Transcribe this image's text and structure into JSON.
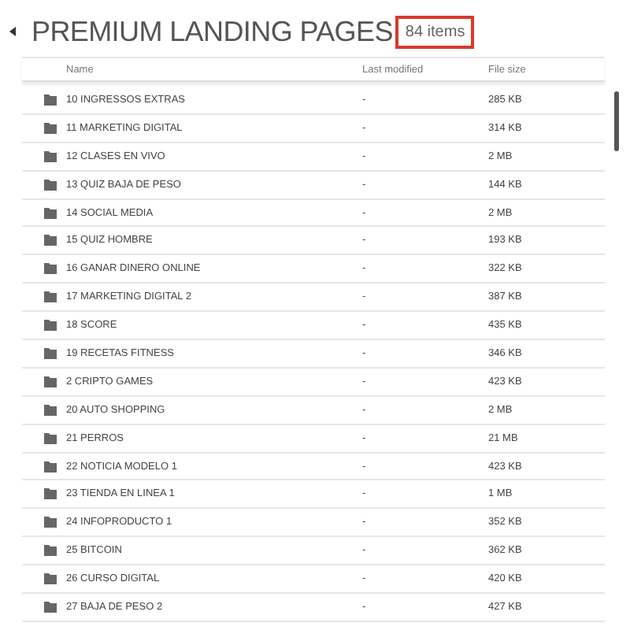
{
  "title": "PREMIUM LANDING PAGES",
  "item_count": {
    "text": "84 items",
    "highlighted": true
  },
  "table": {
    "columns": [
      "Name",
      "Last modified",
      "File size"
    ],
    "rows": [
      {
        "name": "10 INGRESSOS EXTRAS",
        "modified": "-",
        "size": "285 KB"
      },
      {
        "name": "11 MARKETING DIGITAL",
        "modified": "-",
        "size": "314 KB"
      },
      {
        "name": "12 CLASES EN VIVO",
        "modified": "-",
        "size": "2 MB"
      },
      {
        "name": "13 QUIZ BAJA DE PESO",
        "modified": "-",
        "size": "144 KB"
      },
      {
        "name": "14 SOCIAL MEDIA",
        "modified": "-",
        "size": "2 MB"
      },
      {
        "name": "15 QUIZ HOMBRE",
        "modified": "-",
        "size": "193 KB"
      },
      {
        "name": "16 GANAR DINERO ONLINE",
        "modified": "-",
        "size": "322 KB"
      },
      {
        "name": "17 MARKETING DIGITAL 2",
        "modified": "-",
        "size": "387 KB"
      },
      {
        "name": "18 SCORE",
        "modified": "-",
        "size": "435 KB"
      },
      {
        "name": "19 RECETAS FITNESS",
        "modified": "-",
        "size": "346 KB"
      },
      {
        "name": "2 CRIPTO GAMES",
        "modified": "-",
        "size": "423 KB"
      },
      {
        "name": "20 AUTO SHOPPING",
        "modified": "-",
        "size": "2 MB"
      },
      {
        "name": "21 PERROS",
        "modified": "-",
        "size": "21 MB"
      },
      {
        "name": "22 NOTICIA MODELO 1",
        "modified": "-",
        "size": "423 KB"
      },
      {
        "name": "23 TIENDA EN LINEA 1",
        "modified": "-",
        "size": "1 MB"
      },
      {
        "name": "24 INFOPRODUCTO 1",
        "modified": "-",
        "size": "352 KB"
      },
      {
        "name": "25 BITCOIN",
        "modified": "-",
        "size": "362 KB"
      },
      {
        "name": "26 CURSO DIGITAL",
        "modified": "-",
        "size": "420 KB"
      },
      {
        "name": "27 BAJA DE PESO 2",
        "modified": "-",
        "size": "427 KB"
      }
    ]
  }
}
